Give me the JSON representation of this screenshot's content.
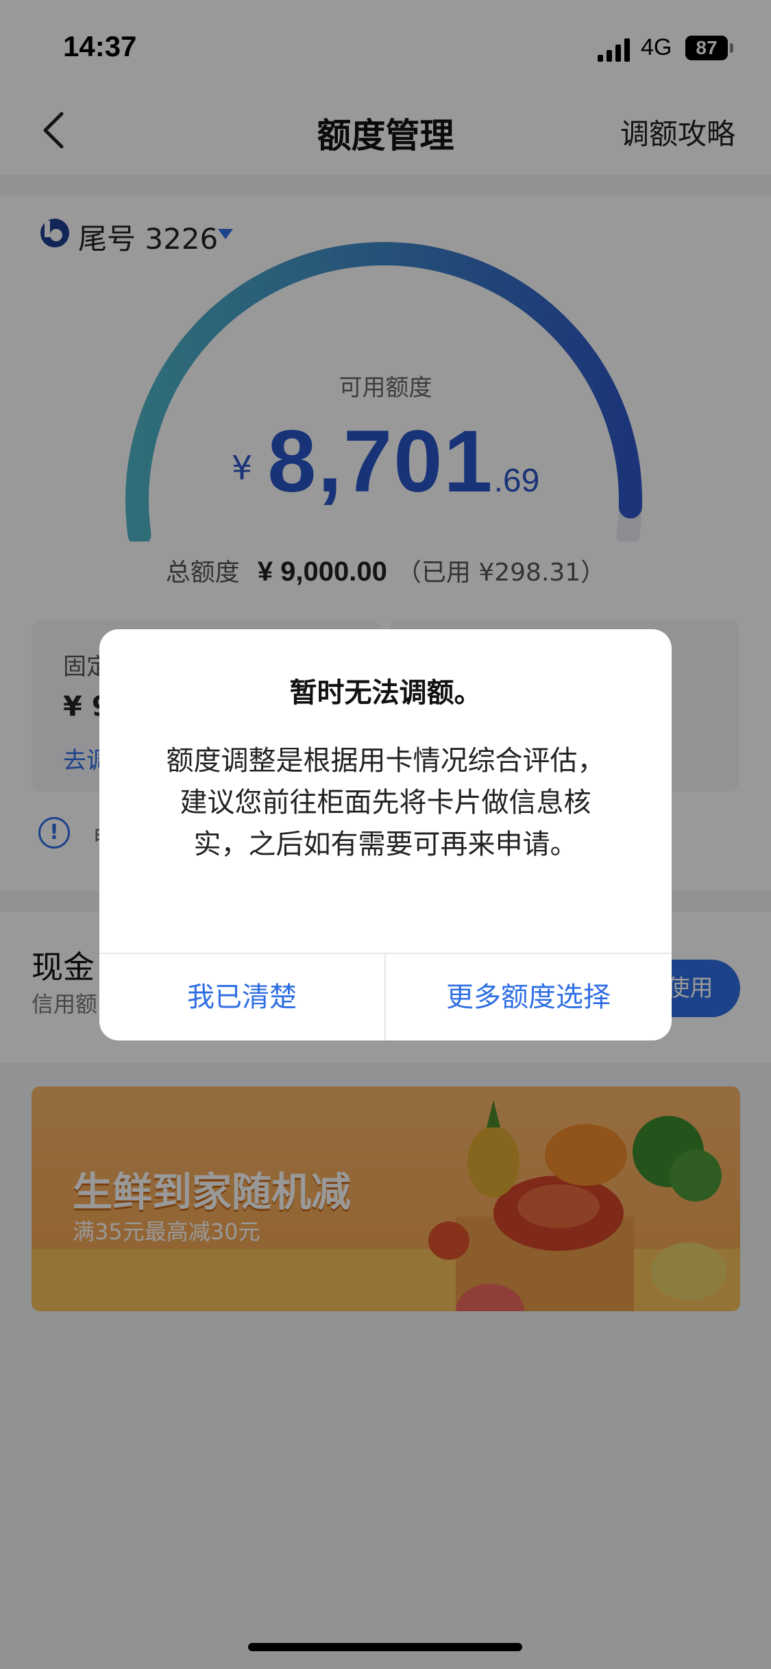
{
  "status_bar": {
    "time": "14:37",
    "network": "4G",
    "battery": "87"
  },
  "nav": {
    "title": "额度管理",
    "right_link": "调额攻略",
    "back_icon": "chevron-left-icon"
  },
  "card": {
    "card_number": "尾号 3226",
    "available_label": "可用额度",
    "currency": "¥",
    "available_integer": "8,701",
    "available_decimal": ".69",
    "total_label": "总额度",
    "total_value": "¥ 9,000.00",
    "used_text": "（已用 ¥298.31）",
    "usage_fraction": 0.9669,
    "gauge_colors": {
      "start": "#4fb6c8",
      "end": "#2f57c8"
    },
    "fixed_label": "固定",
    "fixed_value": "¥ 9",
    "adjust_link": "去调",
    "info_text": "申"
  },
  "cash": {
    "title": "现金",
    "subtitle": "信用额",
    "use_button": "使用"
  },
  "banner": {
    "title": "生鲜到家随机减",
    "subtitle": "满35元最高减30元"
  },
  "dialog": {
    "title": "暂时无法调额。",
    "body": "额度调整是根据用卡情况综合评估，建议您前往柜面先将卡片做信息核实，之后如有需要可再来申请。",
    "cancel": "我已清楚",
    "confirm": "更多额度选择"
  },
  "colors": {
    "accent": "#2f6fe4",
    "amount": "#2855c9"
  }
}
